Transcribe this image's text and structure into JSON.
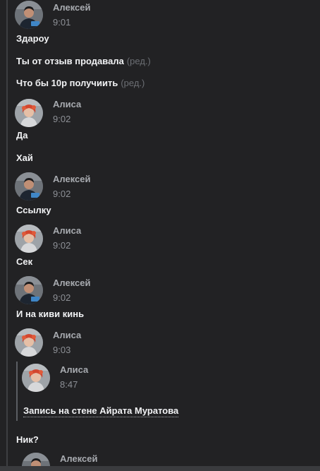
{
  "messages": [
    {
      "author": "Алексей",
      "time": "9:01",
      "texts": [
        "Здароу",
        "Ты от отзыв продавала",
        "Что бы 10р получиить"
      ],
      "edited_label": "(ред.)"
    },
    {
      "author": "Алиса",
      "time": "9:02",
      "texts": [
        "Да",
        "Хай"
      ]
    },
    {
      "author": "Алексей",
      "time": "9:02",
      "texts": [
        "Ссылку"
      ]
    },
    {
      "author": "Алиса",
      "time": "9:02",
      "texts": [
        "Сек"
      ]
    },
    {
      "author": "Алексей",
      "time": "9:02",
      "texts": [
        "И на киви кинь"
      ]
    },
    {
      "author": "Алиса",
      "time": "9:03",
      "texts": [
        "Ник?"
      ]
    },
    {
      "author": "Алексей",
      "time": ""
    }
  ],
  "forwarded": {
    "author": "Алиса",
    "time": "8:47",
    "link_text": "Запись на стене Айрата Муратова"
  },
  "colors": {
    "background": "#222224",
    "text": "#f1f2f4",
    "author_name": "#a8abb0",
    "edited": "#6c6f74"
  }
}
